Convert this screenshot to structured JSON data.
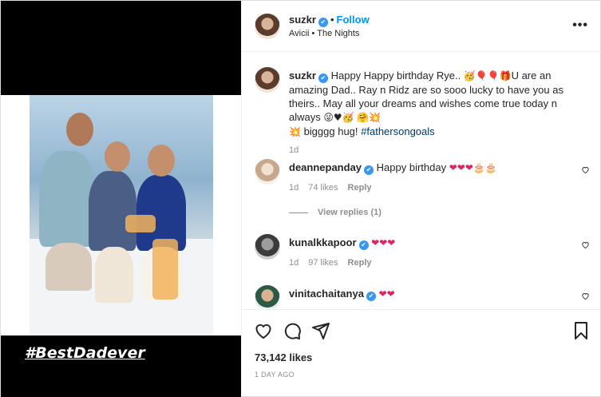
{
  "media": {
    "hashtag_overlay": "#BestDadever"
  },
  "header": {
    "username": "suzkr",
    "separator": "•",
    "follow_label": "Follow",
    "audio": "Avicii • The Nights",
    "more_icon": "more-horizontal-icon"
  },
  "caption": {
    "username": "suzkr",
    "text_part1": "Happy Happy birthday Rye.. ",
    "emojis_1": "🥳🎈🎈🎁",
    "text_part2": "U are an amazing Dad.. Ray n Ridz are so sooo lucky to have you as theirs.. May all your dreams and wishes come true today n always ",
    "emojis_2": "😜♥🥳 🤗💥",
    "emojis_3": "💥",
    "text_part3": " bigggg hug! ",
    "hashtag": "#fathersongoals",
    "time": "1d"
  },
  "comments": [
    {
      "username": "deannepanday",
      "text": "Happy birthday ",
      "emojis": "❤❤❤🎂🎂",
      "time": "1d",
      "likes": "74 likes",
      "reply": "Reply",
      "view_replies": "View replies (1)"
    },
    {
      "username": "kunalkkapoor",
      "text": "",
      "emojis": "❤❤❤",
      "time": "1d",
      "likes": "97 likes",
      "reply": "Reply"
    },
    {
      "username": "vinitachaitanya",
      "text": "",
      "emojis": "❤❤"
    }
  ],
  "actions": {
    "like_icon": "heart-icon",
    "comment_icon": "comment-icon",
    "share_icon": "send-icon",
    "save_icon": "bookmark-icon"
  },
  "stats": {
    "likes": "73,142 likes",
    "time": "1 DAY AGO"
  },
  "colors": {
    "link": "#0095f6",
    "hashtag": "#00376b",
    "verified": "#3897f0",
    "secondary": "#8e8e8e",
    "heart": "#e0245e"
  }
}
